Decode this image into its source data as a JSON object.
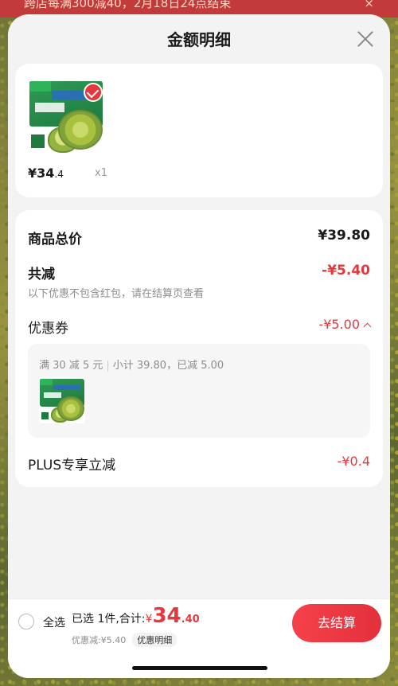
{
  "banner": {
    "text": "跨店每满300减40，2月18日24点结束",
    "close": "×"
  },
  "sheet": {
    "title": "金额明细"
  },
  "product": {
    "price_main": "¥34",
    "price_dec": ".4",
    "qty": "x1"
  },
  "detail": {
    "total_label": "商品总价",
    "total_value": "¥39.80",
    "reduce_label": "共减",
    "reduce_value": "-¥5.40",
    "note": "以下优惠不包含红包，请在结算页查看",
    "coupon_label": "优惠券",
    "coupon_value": "-¥5.00",
    "coupon_rule": "满 30 减 5 元",
    "coupon_sep": "|",
    "coupon_subtotal": "小计 39.80，已减 5.00",
    "plus_label": "PLUS专享立减",
    "plus_value": "-¥0.4"
  },
  "footer": {
    "select_all": "全选",
    "selected": "已选 1件,合计:",
    "yen": "¥",
    "total_int": "34",
    "total_dec": ".40",
    "discount": "优惠减:¥5.40",
    "detail_tag": "优惠明细",
    "checkout": "去结算"
  },
  "colors": {
    "accent": "#e4393c",
    "sheet_bg": "#f3f3f3",
    "card_bg": "#ffffff"
  }
}
